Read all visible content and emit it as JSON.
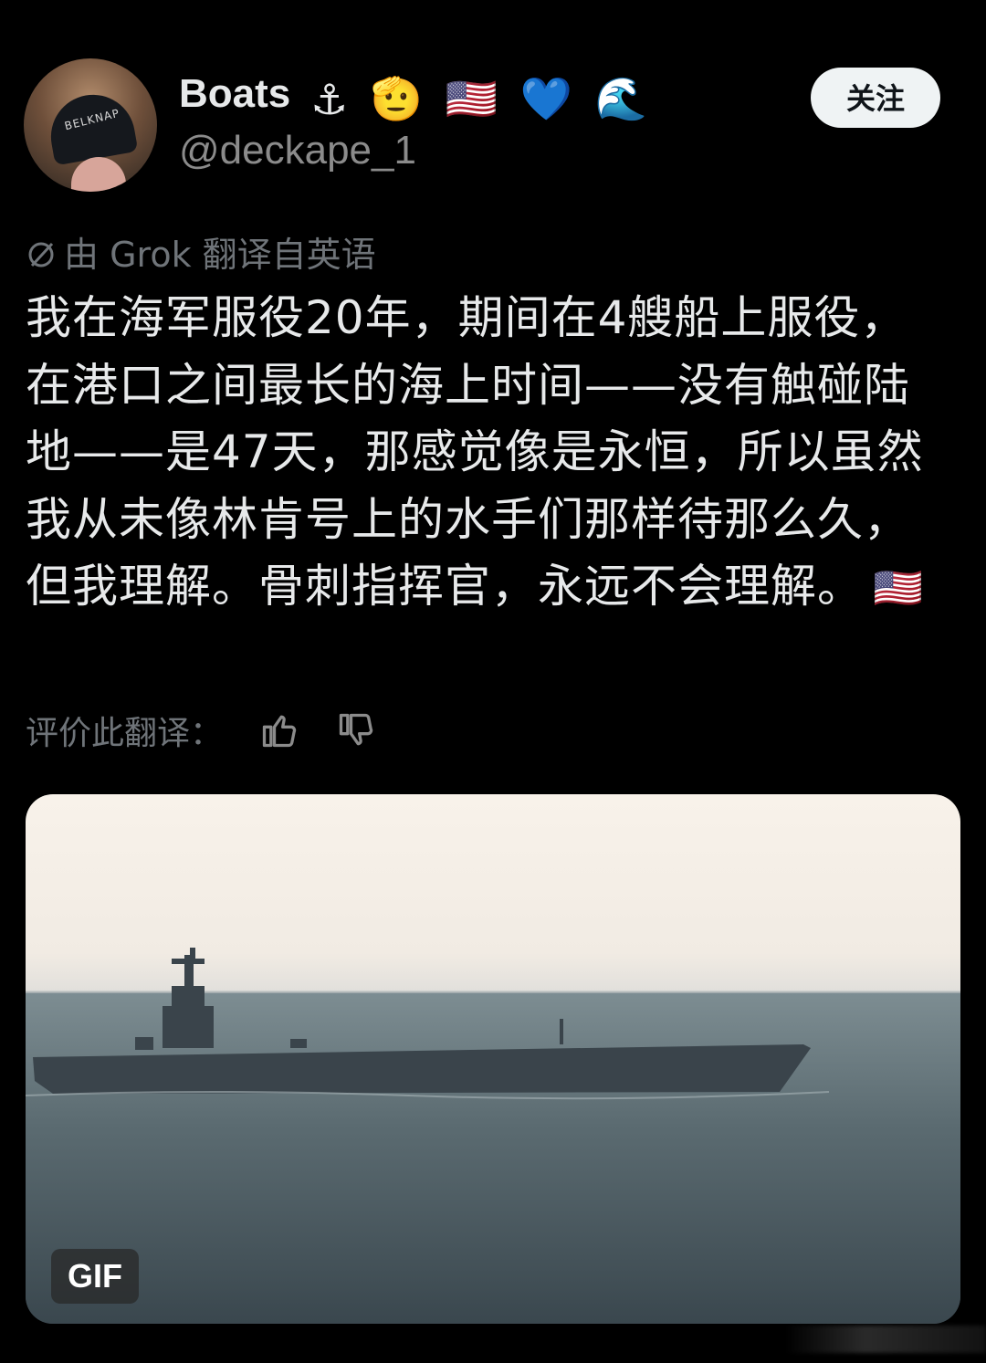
{
  "author": {
    "display_name": "Boats",
    "name_emojis": [
      "⚓",
      "🫡",
      "🇺🇸",
      "💙",
      "🌊"
    ],
    "handle": "@deckape_1",
    "avatar_cap_text": "BELKNAP"
  },
  "follow_button": {
    "label": "关注"
  },
  "translation": {
    "icon": "no-translation-icon",
    "note": "由 Grok 翻译自英语"
  },
  "post": {
    "text": "我在海军服役20年，期间在4艘船上服役，在港口之间最长的海上时间——没有触碰陆地——是47天，那感觉像是永恒，所以虽然我从未像林肯号上的水手们那样待那么久，但我理解。骨刺指挥官，永远不会理解。",
    "trailing_emoji": "🇺🇸"
  },
  "rating": {
    "label": "评价此翻译：",
    "icons": [
      "thumbs-up-icon",
      "thumbs-down-icon"
    ]
  },
  "media": {
    "badge": "GIF",
    "description_icon": "aircraft-carrier-image"
  },
  "colors": {
    "background": "#000000",
    "primary_text": "#e7e9ea",
    "secondary_text": "#6f7479",
    "handle_text": "#8b8b8b",
    "follow_bg": "#eff3f4"
  }
}
